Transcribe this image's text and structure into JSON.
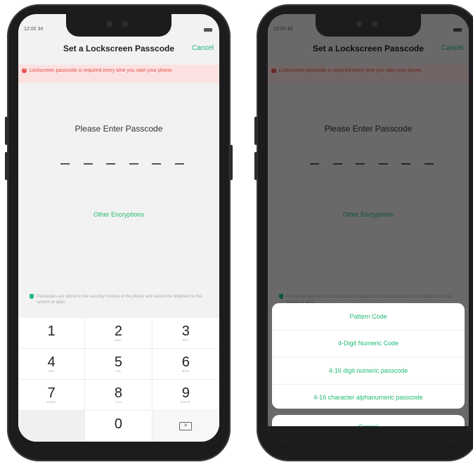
{
  "status": {
    "time": "12:00 34"
  },
  "header": {
    "title": "Set a Lockscreen Passcode",
    "cancel": "Cancel"
  },
  "warning": {
    "text": "Lockscreen passcode is required every time you start your phone."
  },
  "prompt": "Please Enter Passcode",
  "other_encryptions": "Other Encryptions",
  "note": "Passcodes are stored in the security module of the phone and cannot be obtained by the system or apps.",
  "keypad": [
    {
      "num": "1",
      "sub": ""
    },
    {
      "num": "2",
      "sub": "ABC"
    },
    {
      "num": "3",
      "sub": "DEF"
    },
    {
      "num": "4",
      "sub": "GHI"
    },
    {
      "num": "5",
      "sub": "JKL"
    },
    {
      "num": "6",
      "sub": "MNO"
    },
    {
      "num": "7",
      "sub": "PQRS"
    },
    {
      "num": "8",
      "sub": "TUV"
    },
    {
      "num": "9",
      "sub": "WXYZ"
    },
    {
      "num": "0",
      "sub": ""
    }
  ],
  "sheet": {
    "options": [
      "Pattern Code",
      "4-Digit Numeric Code",
      "4-16 digit numeric passcode",
      "4-16 character alphanumeric passcode"
    ],
    "cancel": "Cancel"
  },
  "colors": {
    "accent": "#1fba73",
    "warning": "#e54d4d"
  },
  "icons": {
    "warning": "warning-icon",
    "shield": "shield-icon",
    "backspace": "backspace-icon"
  }
}
